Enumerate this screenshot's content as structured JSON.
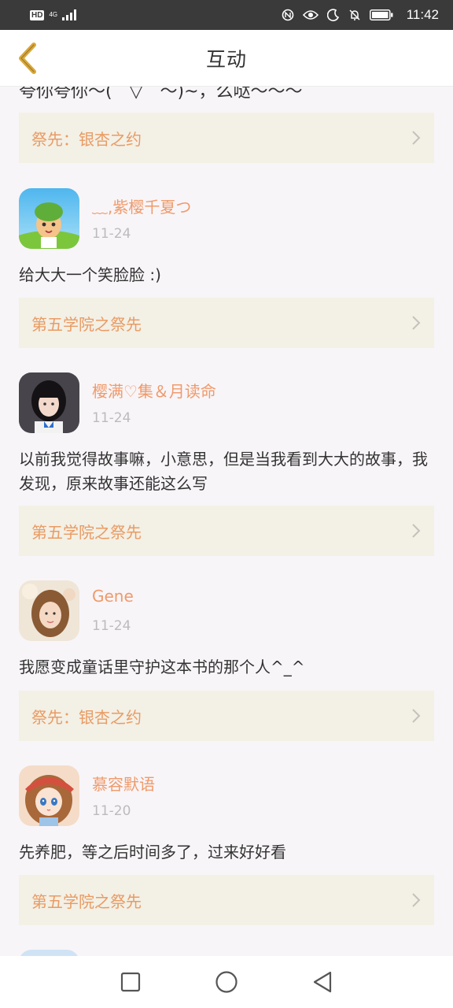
{
  "status_bar": {
    "hd_label": "HD",
    "network_label": "4G",
    "time": "11:42",
    "icons": [
      "signal-icon",
      "nfc-icon",
      "eye-comfort-icon",
      "moon-icon",
      "bell-off-icon",
      "battery-icon"
    ]
  },
  "header": {
    "title": "互动",
    "back_icon": "chevron-left-icon",
    "accent_color": "#d9a838"
  },
  "top_partial": {
    "text": "夸你夸你～(　▽　～)~，么哒～～～",
    "book_link": "祭先：银杏之约"
  },
  "comments": [
    {
      "user": "﹏,紫樱千夏つ",
      "date": "11-24",
      "text": "给大大一个笑脸脸 :)",
      "book_link": "第五学院之祭先"
    },
    {
      "user": "樱满♡集＆月读命",
      "date": "11-24",
      "text": "以前我觉得故事嘛，小意思，但是当我看到大大的故事，我发现，原来故事还能这么写",
      "book_link": "第五学院之祭先"
    },
    {
      "user": "Gene",
      "date": "11-24",
      "text": "我愿变成童话里守护这本书的那个人^_^",
      "book_link": "祭先：银杏之约"
    },
    {
      "user": "慕容默语",
      "date": "11-20",
      "text": "先养肥，等之后时间多了，过来好好看",
      "book_link": "第五学院之祭先"
    }
  ],
  "colors": {
    "username": "#ef9a6b",
    "book_link_text": "#e99b63",
    "book_link_bg": "#f3f0e6",
    "date": "#bcbcbc"
  },
  "nav_bar": {
    "icons": [
      "recent-apps-icon",
      "home-icon",
      "back-triangle-icon"
    ]
  }
}
